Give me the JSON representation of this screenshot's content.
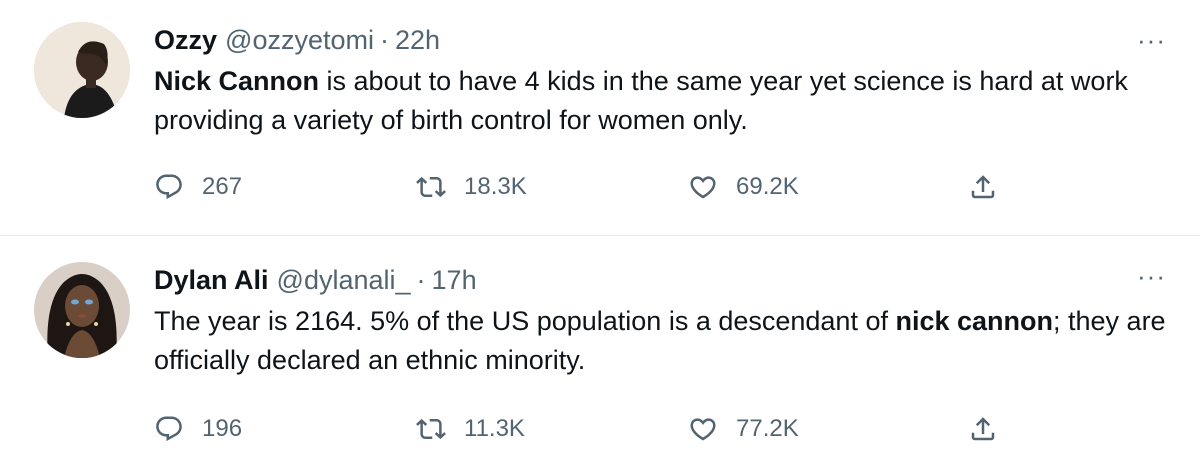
{
  "tweets": [
    {
      "name": "Ozzy",
      "handle": "@ozzyetomi",
      "separator": "·",
      "time": "22h",
      "more": "···",
      "text_parts": [
        {
          "bold": true,
          "text": "Nick Cannon"
        },
        {
          "bold": false,
          "text": " is about to have 4 kids in the same year yet science is hard at work providing a variety of birth control for women only."
        }
      ],
      "replies": "267",
      "retweets": "18.3K",
      "likes": "69.2K",
      "icons": [
        "reply-icon",
        "retweet-icon",
        "like-icon",
        "share-icon"
      ]
    },
    {
      "name": "Dylan Ali",
      "handle": "@dylanali_",
      "separator": "·",
      "time": "17h",
      "more": "···",
      "text_parts": [
        {
          "bold": false,
          "text": "The year is 2164. 5% of the US population is a descendant of "
        },
        {
          "bold": true,
          "text": "nick cannon"
        },
        {
          "bold": false,
          "text": "; they are officially declared an ethnic minority."
        }
      ],
      "replies": "196",
      "retweets": "11.3K",
      "likes": "77.2K",
      "icons": [
        "reply-icon",
        "retweet-icon",
        "like-icon",
        "share-icon"
      ]
    }
  ]
}
